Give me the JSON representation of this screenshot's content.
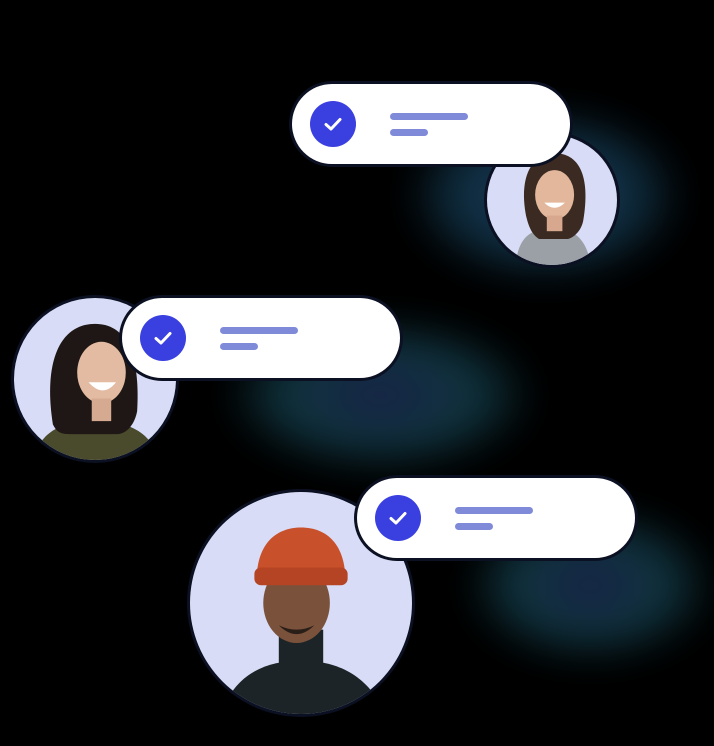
{
  "colors": {
    "background": "#000000",
    "card": "#ffffff",
    "check_badge": "#3a3fe0",
    "check_mark": "#ffffff",
    "placeholder_line": "#7f8ad9",
    "avatar_bg": "#d9dcf6"
  },
  "cards": [
    {
      "icon": "check-circle-icon",
      "text_lines": 2
    },
    {
      "icon": "check-circle-icon",
      "text_lines": 2
    },
    {
      "icon": "check-circle-icon",
      "text_lines": 2
    }
  ],
  "avatars": [
    {
      "subject": "smiling-woman-gray-top"
    },
    {
      "subject": "laughing-woman-olive-jacket"
    },
    {
      "subject": "man-orange-beanie"
    }
  ]
}
